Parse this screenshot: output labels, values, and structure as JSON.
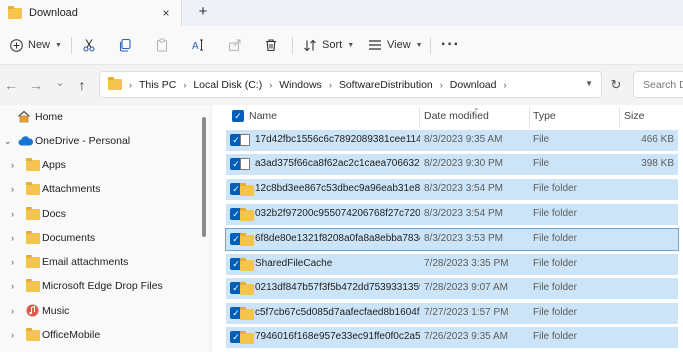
{
  "window": {
    "tab_title": "Download",
    "tab_close_glyph": "×",
    "new_tab_glyph": "+"
  },
  "toolbar": {
    "new_label": "New",
    "sort_label": "Sort",
    "view_label": "View",
    "more_glyph": "···"
  },
  "address": {
    "back_glyph": "←",
    "forward_glyph": "→",
    "recent_glyph": "⌄",
    "up_glyph": "↑",
    "crumbs": [
      "This PC",
      "Local Disk (C:)",
      "Windows",
      "SoftwareDistribution",
      "Download"
    ],
    "separator": "›",
    "refresh_glyph": "↻",
    "search_placeholder": "Search Do"
  },
  "sidebar": {
    "items": [
      {
        "label": "Home",
        "icon": "home-icon"
      },
      {
        "label": "OneDrive - Personal",
        "icon": "cloud-icon"
      },
      {
        "label": "Apps",
        "icon": "folder-icon"
      },
      {
        "label": "Attachments",
        "icon": "folder-icon"
      },
      {
        "label": "Docs",
        "icon": "folder-icon"
      },
      {
        "label": "Documents",
        "icon": "folder-icon"
      },
      {
        "label": "Email attachments",
        "icon": "folder-icon"
      },
      {
        "label": "Microsoft Edge Drop Files",
        "icon": "folder-icon"
      },
      {
        "label": "Music",
        "icon": "music-icon"
      },
      {
        "label": "OfficeMobile",
        "icon": "folder-icon"
      }
    ]
  },
  "columns": {
    "name": "Name",
    "date": "Date modified",
    "type": "Type",
    "size": "Size"
  },
  "files": [
    {
      "name": "17d42fbc1556c6c7892089381cee1143...",
      "date": "8/3/2023 9:35 AM",
      "type": "File",
      "size": "466 KB",
      "icon": "file-icon"
    },
    {
      "name": "a3ad375f66ca8f62ac2c1caea706632e...",
      "date": "8/2/2023 9:30 PM",
      "type": "File",
      "size": "398 KB",
      "icon": "file-icon"
    },
    {
      "name": "12c8bd3ee867c53dbec9a96eab31e81a",
      "date": "8/3/2023 3:54 PM",
      "type": "File folder",
      "size": "",
      "icon": "folder-icon"
    },
    {
      "name": "032b2f97200c955074206768f27c720e",
      "date": "8/3/2023 3:54 PM",
      "type": "File folder",
      "size": "",
      "icon": "folder-icon"
    },
    {
      "name": "6f8de80e1321f8208a0fa8a8ebba783d",
      "date": "8/3/2023 3:53 PM",
      "type": "File folder",
      "size": "",
      "icon": "folder-icon"
    },
    {
      "name": "SharedFileCache",
      "date": "7/28/2023 3:35 PM",
      "type": "File folder",
      "size": "",
      "icon": "folder-icon"
    },
    {
      "name": "0213df847b57f3f5b472dd7539331359",
      "date": "7/28/2023 9:07 AM",
      "type": "File folder",
      "size": "",
      "icon": "folder-icon"
    },
    {
      "name": "c5f7cb67c5d085d7aafecfaed8b1604f",
      "date": "7/27/2023 1:57 PM",
      "type": "File folder",
      "size": "",
      "icon": "folder-icon"
    },
    {
      "name": "7946016f168e957e33ec91ffe0f0c2a5",
      "date": "7/26/2023 9:35 AM",
      "type": "File folder",
      "size": "",
      "icon": "folder-icon"
    }
  ],
  "colors": {
    "selection": "#cce4f7",
    "accent": "#005fb8",
    "folder": "#f5c44d"
  }
}
